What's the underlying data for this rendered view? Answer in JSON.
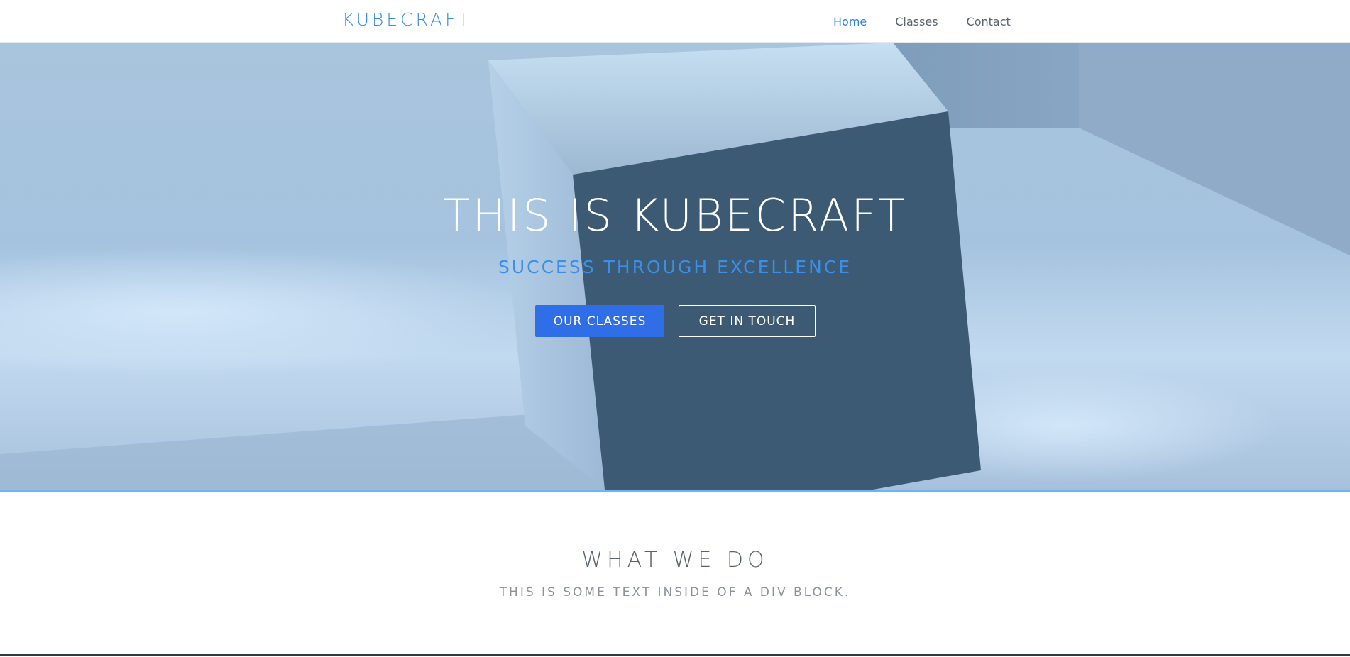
{
  "navbar": {
    "brand": "KUBECRAFT",
    "links": [
      {
        "label": "Home",
        "active": true
      },
      {
        "label": "Classes",
        "active": false
      },
      {
        "label": "Contact",
        "active": false
      }
    ]
  },
  "hero": {
    "title": "THIS IS KUBECRAFT",
    "subtitle": "SUCCESS THROUGH EXCELLENCE",
    "primary_button": "OUR CLASSES",
    "secondary_button": "GET IN TOUCH"
  },
  "section": {
    "title": "WHAT WE DO",
    "text": "THIS IS SOME TEXT INSIDE OF A DIV BLOCK."
  },
  "colors": {
    "accent": "#3b8fe8",
    "primary_button": "#2f6ee6",
    "hero_bar": "#6cb4f5",
    "cube_dark_face": "#3d5a74"
  }
}
